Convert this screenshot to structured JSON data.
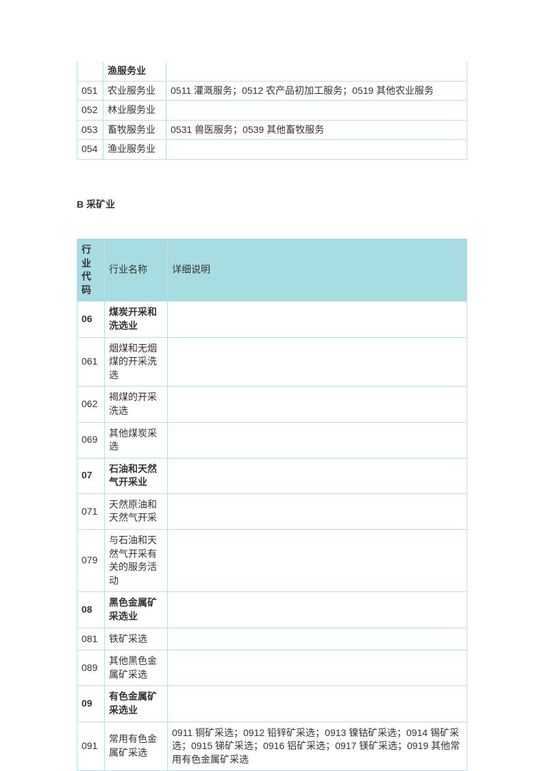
{
  "table1": {
    "rows": [
      {
        "code": "",
        "name": "渔服务业",
        "desc": "",
        "bold": true
      },
      {
        "code": "051",
        "name": "农业服务业",
        "desc": "0511 灌溉服务；0512 农产品初加工服务；0519 其他农业服务"
      },
      {
        "code": "052",
        "name": "林业服务业",
        "desc": ""
      },
      {
        "code": "053",
        "name": "畜牧服务业",
        "desc": "0531 兽医服务；0539 其他畜牧服务"
      },
      {
        "code": "054",
        "name": "渔业服务业",
        "desc": ""
      }
    ]
  },
  "section_b_heading": "B 采矿业",
  "table2": {
    "headers": {
      "code": "行业代码",
      "name": "行业名称",
      "desc": "详细说明"
    },
    "rows": [
      {
        "code": "06",
        "name": "煤炭开采和洗选业",
        "desc": "",
        "bold": true
      },
      {
        "code": "061",
        "name": "烟煤和无烟煤的开采洗选",
        "desc": ""
      },
      {
        "code": "062",
        "name": "褐煤的开采洗选",
        "desc": ""
      },
      {
        "code": "069",
        "name": "其他煤炭采选",
        "desc": ""
      },
      {
        "code": "07",
        "name": "石油和天然气开采业",
        "desc": "",
        "bold": true
      },
      {
        "code": "071",
        "name": "天然原油和天然气开采",
        "desc": ""
      },
      {
        "code": "079",
        "name": "与石油和天然气开采有关的服务活动",
        "desc": ""
      },
      {
        "code": "08",
        "name": "黑色金属矿采选业",
        "desc": "",
        "bold": true
      },
      {
        "code": "081",
        "name": "铁矿采选",
        "desc": ""
      },
      {
        "code": "089",
        "name": "其他黑色金属矿采选",
        "desc": ""
      },
      {
        "code": "09",
        "name": "有色金属矿采选业",
        "desc": "",
        "bold": true
      },
      {
        "code": "091",
        "name": "常用有色金属矿采选",
        "desc": "0911 铜矿采选；0912 铅锌矿采选；0913 镍钴矿采选；0914 锡矿采选；0915 锑矿采选；0916 铝矿采选；0917 镁矿采选；0919 其他常用有色金属矿采选"
      }
    ]
  },
  "chart_data": {
    "type": "table",
    "tables": [
      {
        "columns": [
          "行业代码",
          "行业名称",
          "详细说明"
        ],
        "rows": [
          [
            "",
            "渔服务业",
            ""
          ],
          [
            "051",
            "农业服务业",
            "0511 灌溉服务；0512 农产品初加工服务；0519 其他农业服务"
          ],
          [
            "052",
            "林业服务业",
            ""
          ],
          [
            "053",
            "畜牧服务业",
            "0531 兽医服务；0539 其他畜牧服务"
          ],
          [
            "054",
            "渔业服务业",
            ""
          ]
        ]
      },
      {
        "title": "B 采矿业",
        "columns": [
          "行业代码",
          "行业名称",
          "详细说明"
        ],
        "rows": [
          [
            "06",
            "煤炭开采和洗选业",
            ""
          ],
          [
            "061",
            "烟煤和无烟煤的开采洗选",
            ""
          ],
          [
            "062",
            "褐煤的开采洗选",
            ""
          ],
          [
            "069",
            "其他煤炭采选",
            ""
          ],
          [
            "07",
            "石油和天然气开采业",
            ""
          ],
          [
            "071",
            "天然原油和天然气开采",
            ""
          ],
          [
            "079",
            "与石油和天然气开采有关的服务活动",
            ""
          ],
          [
            "08",
            "黑色金属矿采选业",
            ""
          ],
          [
            "081",
            "铁矿采选",
            ""
          ],
          [
            "089",
            "其他黑色金属矿采选",
            ""
          ],
          [
            "09",
            "有色金属矿采选业",
            ""
          ],
          [
            "091",
            "常用有色金属矿采选",
            "0911 铜矿采选；0912 铅锌矿采选；0913 镍钴矿采选；0914 锡矿采选；0915 锑矿采选；0916 铝矿采选；0917 镁矿采选；0919 其他常用有色金属矿采选"
          ]
        ]
      }
    ]
  }
}
